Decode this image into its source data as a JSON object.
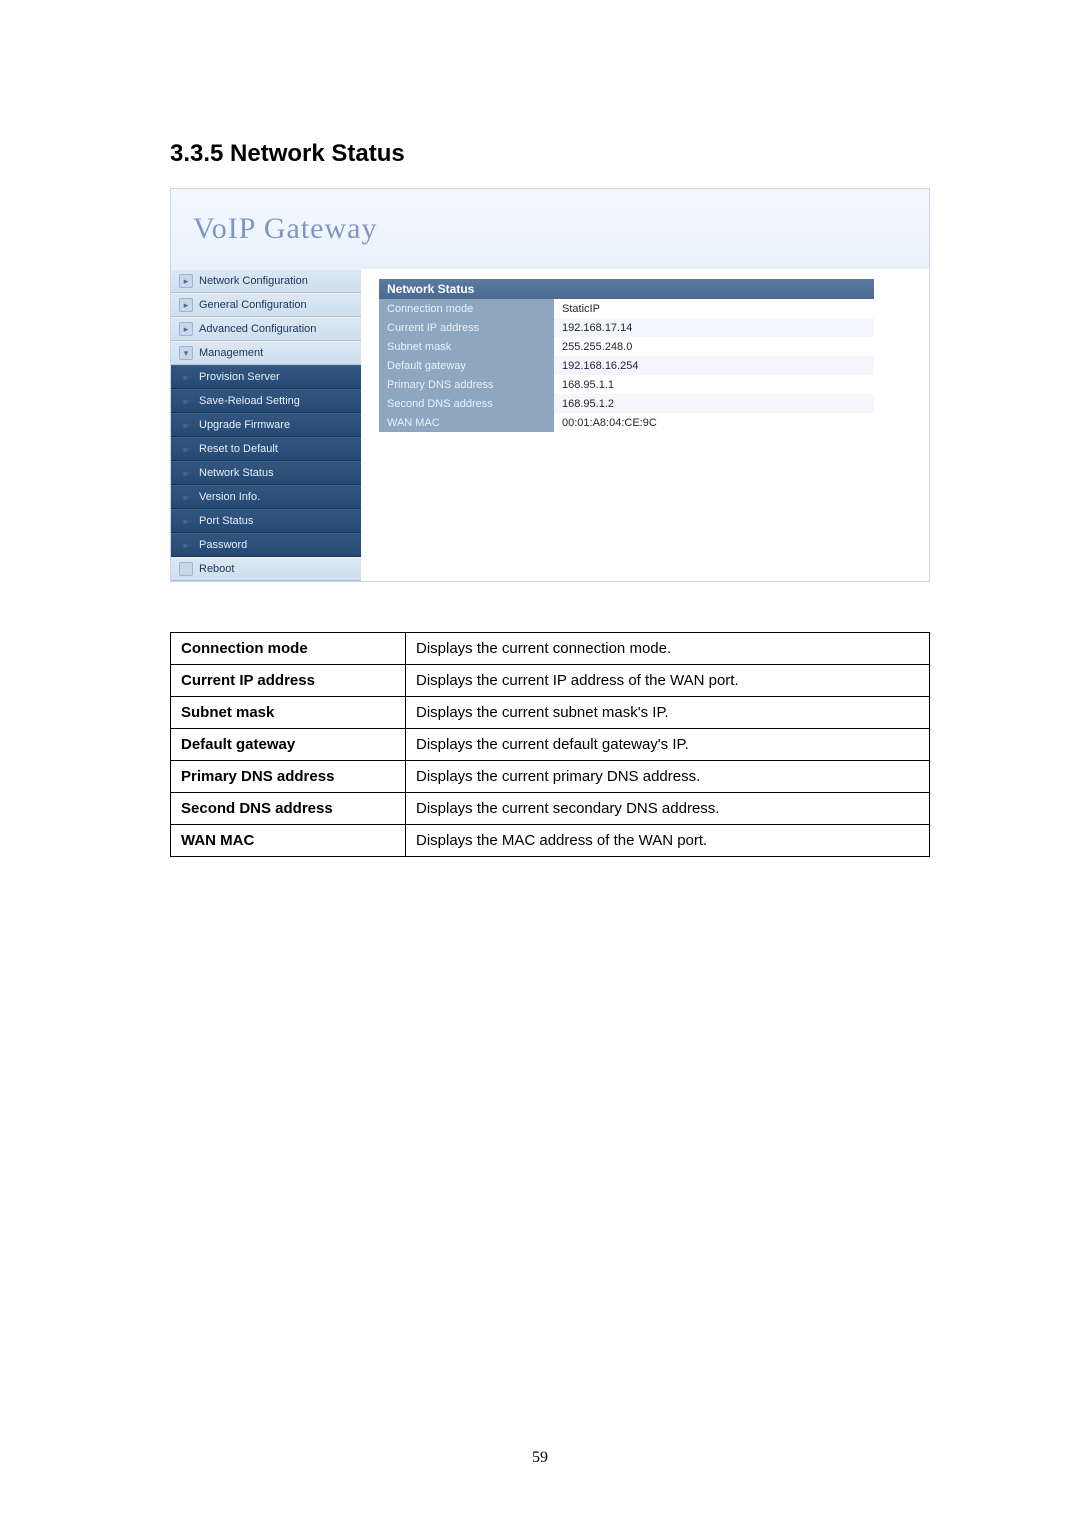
{
  "section_title": "3.3.5 Network Status",
  "logo_text": "VoIP  Gateway",
  "sidebar": {
    "items": [
      {
        "label": "Network Configuration",
        "light": true,
        "arrow": "▸"
      },
      {
        "label": "General Configuration",
        "light": true,
        "arrow": "▸"
      },
      {
        "label": "Advanced Configuration",
        "light": true,
        "arrow": "▸"
      },
      {
        "label": "Management",
        "light": true,
        "arrow": "▾"
      },
      {
        "label": "Provision Server",
        "light": false,
        "arrow": "▹"
      },
      {
        "label": "Save-Reload Setting",
        "light": false,
        "arrow": "▹"
      },
      {
        "label": "Upgrade Firmware",
        "light": false,
        "arrow": "▹"
      },
      {
        "label": "Reset to Default",
        "light": false,
        "arrow": "▹"
      },
      {
        "label": "Network Status",
        "light": false,
        "arrow": "▹"
      },
      {
        "label": "Version Info.",
        "light": false,
        "arrow": "▹"
      },
      {
        "label": "Port Status",
        "light": false,
        "arrow": "▹"
      },
      {
        "label": "Password",
        "light": false,
        "arrow": "▹"
      },
      {
        "label": "Reboot",
        "light": true,
        "arrow": ""
      }
    ]
  },
  "panel_title": "Network Status",
  "status_rows": [
    {
      "k": "Connection mode",
      "v": "StaticIP"
    },
    {
      "k": "Current IP address",
      "v": "192.168.17.14"
    },
    {
      "k": "Subnet mask",
      "v": "255.255.248.0"
    },
    {
      "k": "Default gateway",
      "v": "192.168.16.254"
    },
    {
      "k": "Primary DNS address",
      "v": "168.95.1.1"
    },
    {
      "k": "Second DNS address",
      "v": "168.95.1.2"
    },
    {
      "k": "WAN MAC",
      "v": "00:01:A8:04:CE:9C"
    }
  ],
  "desc_rows": [
    {
      "name": "Connection mode",
      "desc": "Displays the current connection mode."
    },
    {
      "name": "Current IP address",
      "desc": "Displays the current IP address of the WAN port."
    },
    {
      "name": "Subnet mask",
      "desc": "Displays the current subnet mask's IP."
    },
    {
      "name": "Default gateway",
      "desc": "Displays the current default gateway's IP."
    },
    {
      "name": "Primary DNS address",
      "desc": "Displays the current primary DNS address."
    },
    {
      "name": "Second DNS address",
      "desc": "Displays the current secondary DNS address."
    },
    {
      "name": "WAN MAC",
      "desc": "Displays the MAC address of the WAN port."
    }
  ],
  "page_number": "59"
}
